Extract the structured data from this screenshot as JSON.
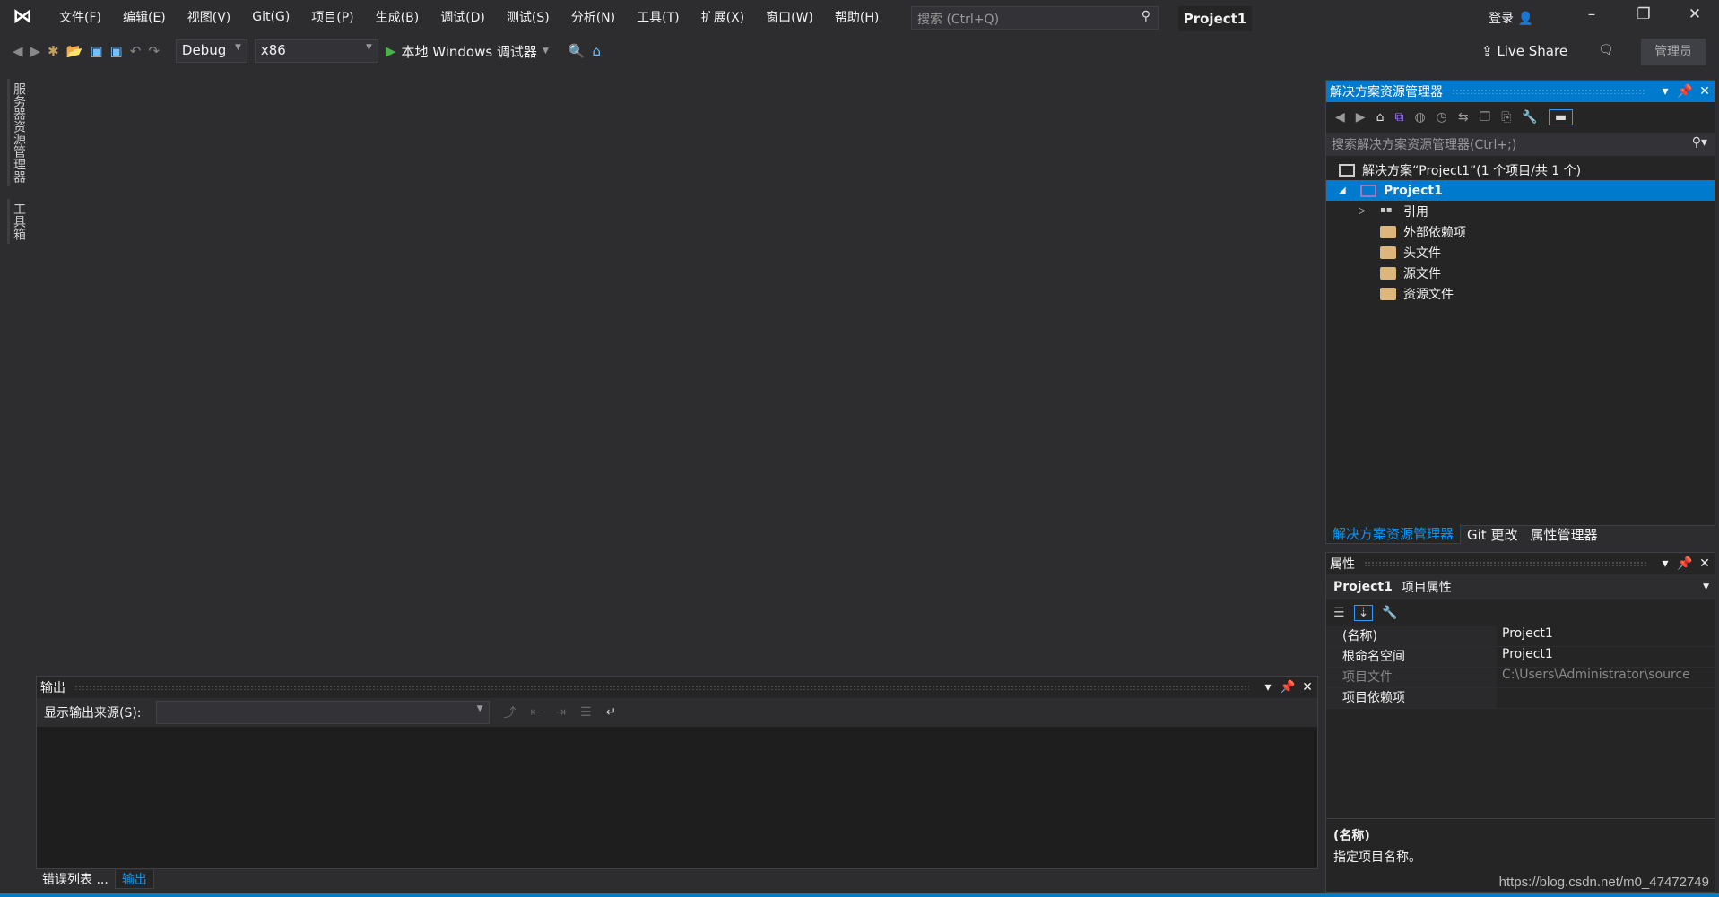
{
  "menubar": {
    "items": [
      "文件(F)",
      "编辑(E)",
      "视图(V)",
      "Git(G)",
      "项目(P)",
      "生成(B)",
      "调试(D)",
      "测试(S)",
      "分析(N)",
      "工具(T)",
      "扩展(X)",
      "窗口(W)",
      "帮助(H)"
    ],
    "search_placeholder": "搜索 (Ctrl+Q)",
    "project_title": "Project1",
    "login": "登录"
  },
  "toolbar": {
    "configuration": "Debug",
    "platform": "x86",
    "run_label": "本地 Windows 调试器",
    "live_share": "Live Share",
    "admin": "管理员"
  },
  "left_tabs": [
    "服务器资源管理器",
    "工具箱"
  ],
  "solution_explorer": {
    "title": "解决方案资源管理器",
    "search_placeholder": "搜索解决方案资源管理器(Ctrl+;)",
    "solution": "解决方案“Project1”(1 个项目/共 1 个)",
    "project": "Project1",
    "items": [
      "引用",
      "外部依赖项",
      "头文件",
      "源文件",
      "资源文件"
    ],
    "tabs": [
      "解决方案资源管理器",
      "Git 更改",
      "属性管理器"
    ]
  },
  "properties": {
    "title": "属性",
    "object": "Project1",
    "object_type": "项目属性",
    "rows": [
      {
        "key": "(名称)",
        "value": "Project1"
      },
      {
        "key": "根命名空间",
        "value": "Project1"
      },
      {
        "key": "项目文件",
        "value": "C:\\Users\\Administrator\\source"
      },
      {
        "key": "项目依赖项",
        "value": ""
      }
    ],
    "desc_title": "(名称)",
    "desc_text": "指定项目名称。"
  },
  "output": {
    "title": "输出",
    "source_label": "显示输出来源(S):",
    "source_value": "",
    "tabs": [
      "错误列表 ...",
      "输出"
    ]
  },
  "watermark": "https://blog.csdn.net/m0_47472749",
  "colors": {
    "accent": "#007acc",
    "background": "#2d2d30",
    "panel": "#252526"
  }
}
